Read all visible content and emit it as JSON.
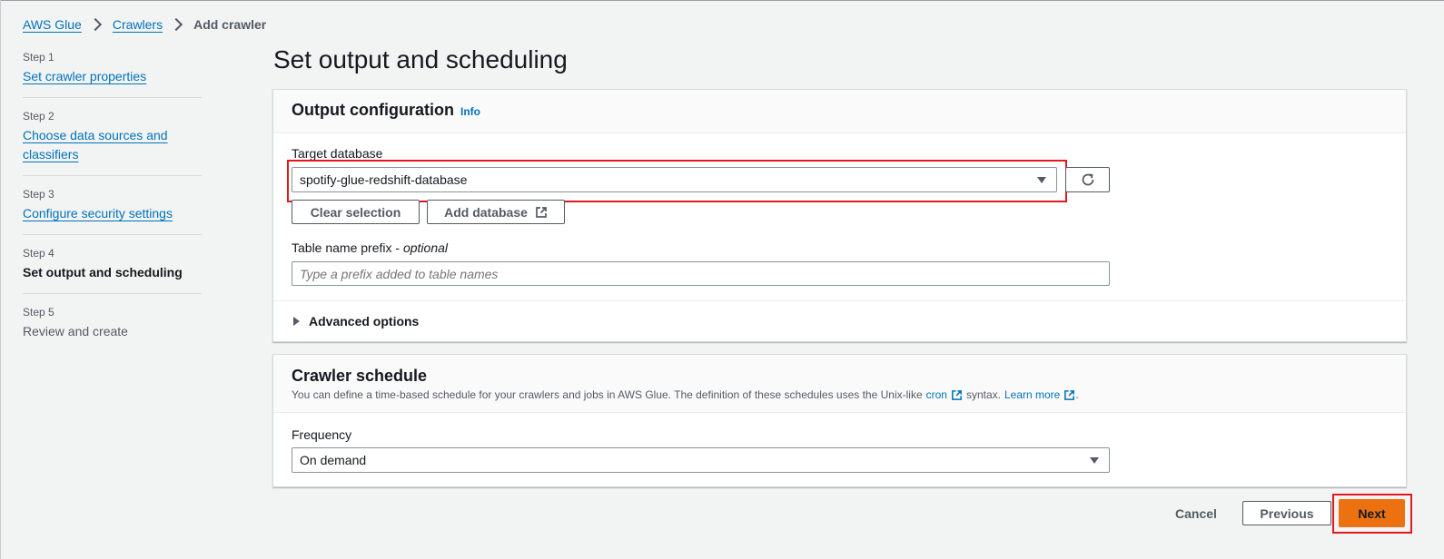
{
  "breadcrumb": {
    "items": [
      "AWS Glue",
      "Crawlers"
    ],
    "current": "Add crawler"
  },
  "steps": [
    {
      "num": "Step 1",
      "label": "Set crawler properties"
    },
    {
      "num": "Step 2",
      "label": "Choose data sources and classifiers"
    },
    {
      "num": "Step 3",
      "label": "Configure security settings"
    },
    {
      "num": "Step 4",
      "label": "Set output and scheduling"
    },
    {
      "num": "Step 5",
      "label": "Review and create"
    }
  ],
  "page_title": "Set output and scheduling",
  "output_config": {
    "title": "Output configuration",
    "info": "Info",
    "target_db_label": "Target database",
    "target_db_value": "spotify-glue-redshift-database",
    "clear_selection": "Clear selection",
    "add_database": "Add database",
    "prefix_label": "Table name prefix",
    "prefix_optional": "optional",
    "prefix_placeholder": "Type a prefix added to table names",
    "advanced_options": "Advanced options"
  },
  "schedule": {
    "title": "Crawler schedule",
    "desc_part1": "You can define a time-based schedule for your crawlers and jobs in AWS Glue. The definition of these schedules uses the Unix-like",
    "cron_link": "cron",
    "desc_part2": "syntax.",
    "learn_more": "Learn more",
    "desc_end": ".",
    "frequency_label": "Frequency",
    "frequency_value": "On demand"
  },
  "footer": {
    "cancel": "Cancel",
    "previous": "Previous",
    "next": "Next"
  },
  "colors": {
    "link": "#0073bb",
    "primary_button": "#ec7211",
    "highlight_box": "#e3181e"
  }
}
